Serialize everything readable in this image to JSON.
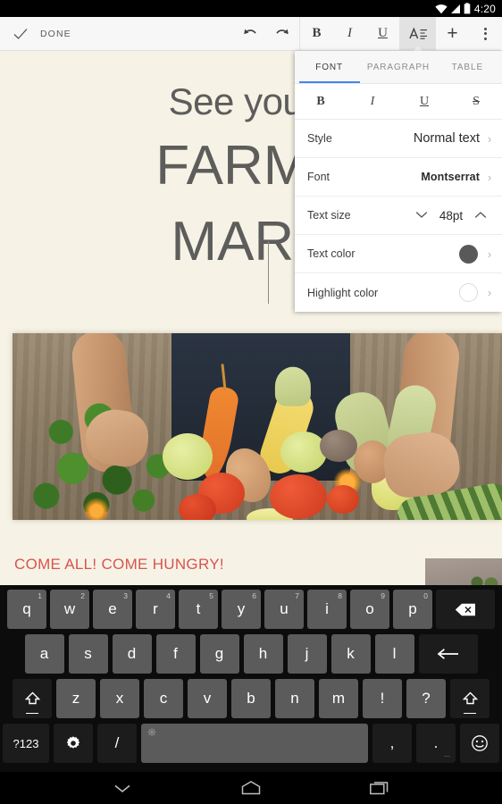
{
  "status_bar": {
    "time": "4:20",
    "icons": [
      "wifi-icon",
      "cellular-signal-icon",
      "battery-icon"
    ]
  },
  "toolbar": {
    "done_label": "DONE",
    "check_icon": "check-icon",
    "buttons": [
      {
        "name": "undo-button",
        "icon": "undo-icon",
        "label": ""
      },
      {
        "name": "redo-button",
        "icon": "redo-icon",
        "label": ""
      },
      {
        "name": "bold-button",
        "icon": "bold-icon",
        "label": "B"
      },
      {
        "name": "italic-button",
        "icon": "italic-icon",
        "label": "I"
      },
      {
        "name": "underline-button",
        "icon": "underline-icon",
        "label": "U"
      },
      {
        "name": "format-button",
        "icon": "format-text-icon",
        "label": "A"
      },
      {
        "name": "insert-button",
        "icon": "plus-icon",
        "label": "+"
      },
      {
        "name": "overflow-button",
        "icon": "more-vertical-icon",
        "label": ""
      }
    ]
  },
  "document": {
    "line1": "See you a",
    "line2": "FARME",
    "line3": "MARK",
    "red_heading": "COME ALL! COME HUNGRY!",
    "background_color": "#f6f3e6",
    "text_color": "#5d5d5b",
    "red_color": "#d9534f",
    "image_alt": "person-holding-vegetables-photo",
    "thumbnail_alt": "second-image-thumbnail"
  },
  "format_panel": {
    "tabs": [
      {
        "label": "FONT",
        "active": true
      },
      {
        "label": "PARAGRAPH",
        "active": false
      },
      {
        "label": "TABLE",
        "active": false
      }
    ],
    "active_tab_color": "#4285f4",
    "style_buttons": [
      {
        "name": "panel-bold-button",
        "label": "B"
      },
      {
        "name": "panel-italic-button",
        "label": "I"
      },
      {
        "name": "panel-underline-button",
        "label": "U"
      },
      {
        "name": "panel-strikethrough-button",
        "label": "S"
      }
    ],
    "rows": {
      "style": {
        "label": "Style",
        "value": "Normal text"
      },
      "font": {
        "label": "Font",
        "value": "Montserrat"
      },
      "text_size": {
        "label": "Text size",
        "value": "48pt",
        "decrease_icon": "chevron-down-icon",
        "increase_icon": "chevron-up-icon"
      },
      "text_color": {
        "label": "Text color",
        "swatch": "#595959"
      },
      "highlight_color": {
        "label": "Highlight color",
        "swatch": "#ffffff"
      }
    }
  },
  "keyboard": {
    "row1": [
      {
        "key": "q",
        "num": "1"
      },
      {
        "key": "w",
        "num": "2"
      },
      {
        "key": "e",
        "num": "3"
      },
      {
        "key": "r",
        "num": "4"
      },
      {
        "key": "t",
        "num": "5"
      },
      {
        "key": "y",
        "num": "6"
      },
      {
        "key": "u",
        "num": "7"
      },
      {
        "key": "i",
        "num": "8"
      },
      {
        "key": "o",
        "num": "9"
      },
      {
        "key": "p",
        "num": "0"
      }
    ],
    "backspace": "backspace-icon",
    "row2": [
      "a",
      "s",
      "d",
      "f",
      "g",
      "h",
      "j",
      "k",
      "l"
    ],
    "enter": "enter-icon",
    "row3": [
      "z",
      "x",
      "c",
      "v",
      "b",
      "n",
      "m",
      "!",
      "?"
    ],
    "shift_left": "shift-icon",
    "shift_right": "shift-icon",
    "row4": {
      "symbols": "?123",
      "settings": "gear-icon",
      "slash": "/",
      "space": "space-key",
      "comma": ",",
      "period": ".",
      "emoji": "emoji-icon"
    }
  },
  "nav_bar": {
    "back": "chevron-down-icon",
    "home": "home-icon",
    "recents": "recents-icon"
  }
}
